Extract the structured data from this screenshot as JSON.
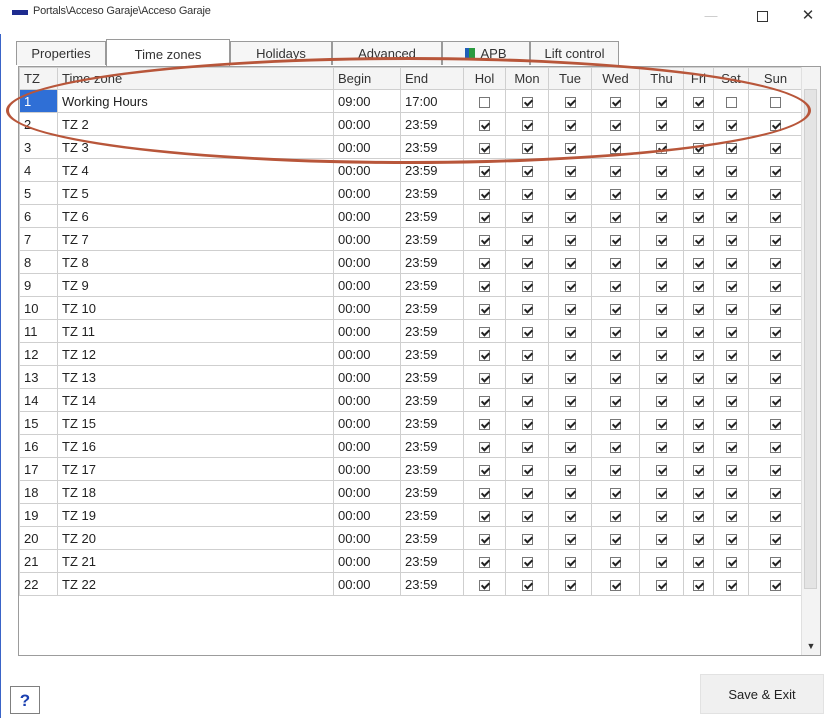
{
  "window": {
    "title": "Portals\\Acceso Garaje\\Acceso Garaje",
    "minimize_icon": "—",
    "close_icon": "✕"
  },
  "tabs": [
    {
      "label": "Properties"
    },
    {
      "label": "Time zones",
      "active": true
    },
    {
      "label": "Holidays"
    },
    {
      "label": "Advanced"
    },
    {
      "label": "APB",
      "icon": "apb-icon"
    },
    {
      "label": "Lift control"
    }
  ],
  "grid": {
    "columns": [
      "TZ",
      "Time zone",
      "Begin",
      "End",
      "Hol",
      "Mon",
      "Tue",
      "Wed",
      "Thu",
      "Fri",
      "Sat",
      "Sun"
    ],
    "selected_row": 0,
    "rows": [
      {
        "tz": "1",
        "name": "Working Hours",
        "begin": "09:00",
        "end": "17:00",
        "days": [
          false,
          true,
          true,
          true,
          true,
          true,
          false,
          false
        ]
      },
      {
        "tz": "2",
        "name": "TZ 2",
        "begin": "00:00",
        "end": "23:59",
        "days": [
          true,
          true,
          true,
          true,
          true,
          true,
          true,
          true
        ]
      },
      {
        "tz": "3",
        "name": "TZ 3",
        "begin": "00:00",
        "end": "23:59",
        "days": [
          true,
          true,
          true,
          true,
          true,
          true,
          true,
          true
        ]
      },
      {
        "tz": "4",
        "name": "TZ 4",
        "begin": "00:00",
        "end": "23:59",
        "days": [
          true,
          true,
          true,
          true,
          true,
          true,
          true,
          true
        ]
      },
      {
        "tz": "5",
        "name": "TZ 5",
        "begin": "00:00",
        "end": "23:59",
        "days": [
          true,
          true,
          true,
          true,
          true,
          true,
          true,
          true
        ]
      },
      {
        "tz": "6",
        "name": "TZ 6",
        "begin": "00:00",
        "end": "23:59",
        "days": [
          true,
          true,
          true,
          true,
          true,
          true,
          true,
          true
        ]
      },
      {
        "tz": "7",
        "name": "TZ 7",
        "begin": "00:00",
        "end": "23:59",
        "days": [
          true,
          true,
          true,
          true,
          true,
          true,
          true,
          true
        ]
      },
      {
        "tz": "8",
        "name": "TZ 8",
        "begin": "00:00",
        "end": "23:59",
        "days": [
          true,
          true,
          true,
          true,
          true,
          true,
          true,
          true
        ]
      },
      {
        "tz": "9",
        "name": "TZ 9",
        "begin": "00:00",
        "end": "23:59",
        "days": [
          true,
          true,
          true,
          true,
          true,
          true,
          true,
          true
        ]
      },
      {
        "tz": "10",
        "name": "TZ 10",
        "begin": "00:00",
        "end": "23:59",
        "days": [
          true,
          true,
          true,
          true,
          true,
          true,
          true,
          true
        ]
      },
      {
        "tz": "11",
        "name": "TZ 11",
        "begin": "00:00",
        "end": "23:59",
        "days": [
          true,
          true,
          true,
          true,
          true,
          true,
          true,
          true
        ]
      },
      {
        "tz": "12",
        "name": "TZ 12",
        "begin": "00:00",
        "end": "23:59",
        "days": [
          true,
          true,
          true,
          true,
          true,
          true,
          true,
          true
        ]
      },
      {
        "tz": "13",
        "name": "TZ 13",
        "begin": "00:00",
        "end": "23:59",
        "days": [
          true,
          true,
          true,
          true,
          true,
          true,
          true,
          true
        ]
      },
      {
        "tz": "14",
        "name": "TZ 14",
        "begin": "00:00",
        "end": "23:59",
        "days": [
          true,
          true,
          true,
          true,
          true,
          true,
          true,
          true
        ]
      },
      {
        "tz": "15",
        "name": "TZ 15",
        "begin": "00:00",
        "end": "23:59",
        "days": [
          true,
          true,
          true,
          true,
          true,
          true,
          true,
          true
        ]
      },
      {
        "tz": "16",
        "name": "TZ 16",
        "begin": "00:00",
        "end": "23:59",
        "days": [
          true,
          true,
          true,
          true,
          true,
          true,
          true,
          true
        ]
      },
      {
        "tz": "17",
        "name": "TZ 17",
        "begin": "00:00",
        "end": "23:59",
        "days": [
          true,
          true,
          true,
          true,
          true,
          true,
          true,
          true
        ]
      },
      {
        "tz": "18",
        "name": "TZ 18",
        "begin": "00:00",
        "end": "23:59",
        "days": [
          true,
          true,
          true,
          true,
          true,
          true,
          true,
          true
        ]
      },
      {
        "tz": "19",
        "name": "TZ 19",
        "begin": "00:00",
        "end": "23:59",
        "days": [
          true,
          true,
          true,
          true,
          true,
          true,
          true,
          true
        ]
      },
      {
        "tz": "20",
        "name": "TZ 20",
        "begin": "00:00",
        "end": "23:59",
        "days": [
          true,
          true,
          true,
          true,
          true,
          true,
          true,
          true
        ]
      },
      {
        "tz": "21",
        "name": "TZ 21",
        "begin": "00:00",
        "end": "23:59",
        "days": [
          true,
          true,
          true,
          true,
          true,
          true,
          true,
          true
        ]
      },
      {
        "tz": "22",
        "name": "TZ 22",
        "begin": "00:00",
        "end": "23:59",
        "days": [
          true,
          true,
          true,
          true,
          true,
          true,
          true,
          true
        ]
      }
    ]
  },
  "footer": {
    "help_label": "?",
    "save_label": "Save & Exit"
  },
  "colors": {
    "selection": "#2f6fd6",
    "annotation": "#b8563a",
    "app_icon": "#1e2b8f"
  }
}
